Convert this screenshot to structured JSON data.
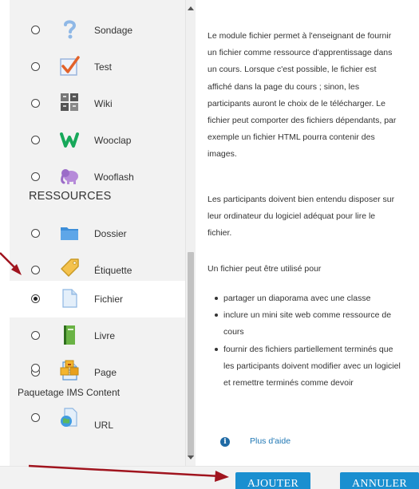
{
  "activities": [
    {
      "label": "Sondage",
      "icon": "question-mark-icon"
    },
    {
      "label": "Test",
      "icon": "checkmark-quiz-icon"
    },
    {
      "label": "Wiki",
      "icon": "puzzle-wiki-icon"
    },
    {
      "label": "Wooclap",
      "icon": "wooclap-w-icon"
    },
    {
      "label": "Wooflash",
      "icon": "elephant-icon"
    }
  ],
  "section_title": "RESSOURCES",
  "resources": [
    {
      "label": "Dossier",
      "icon": "folder-icon",
      "selected": false
    },
    {
      "label": "Étiquette",
      "icon": "label-tag-icon",
      "selected": false
    },
    {
      "label": "Fichier",
      "icon": "file-icon",
      "selected": true
    },
    {
      "label": "Livre",
      "icon": "book-icon",
      "selected": false
    },
    {
      "label": "Page",
      "icon": "page-icon",
      "selected": false
    },
    {
      "label": "Paquetage IMS Content",
      "icon": "package-boxes-icon",
      "selected": false
    },
    {
      "label": "URL",
      "icon": "url-globe-icon",
      "selected": false
    }
  ],
  "description": {
    "lines_p1": [
      "Le module fichier permet à l'enseignant de fournir",
      "un fichier comme ressource d'apprentissage dans",
      "un cours. Lorsque c'est possible, le fichier est",
      "affiché dans la page du cours ; sinon, les",
      "participants auront le choix de le télécharger. Le",
      "fichier peut comporter des fichiers dépendants, par",
      "exemple un fichier HTML pourra contenir des",
      "images."
    ],
    "lines_p2": [
      "Les participants doivent bien entendu disposer sur",
      "leur ordinateur du logiciel adéquat pour lire le",
      "fichier."
    ],
    "p3": "Un fichier peut être utilisé pour",
    "bullets": [
      [
        "partager un diaporama avec une classe"
      ],
      [
        "inclure un mini site web comme ressource de",
        "cours"
      ],
      [
        "fournir des fichiers partiellement terminés que",
        "les participants doivent modifier avec un logiciel",
        "et remettre terminés comme devoir"
      ]
    ]
  },
  "help": {
    "icon": "info-icon",
    "icon_glyph": "i",
    "label": "Plus d'aide"
  },
  "buttons": {
    "add": "AJOUTER",
    "cancel": "ANNULER"
  },
  "colors": {
    "button": "#1a8fd0",
    "arrow": "#a0141e",
    "link": "#1f77b4"
  }
}
